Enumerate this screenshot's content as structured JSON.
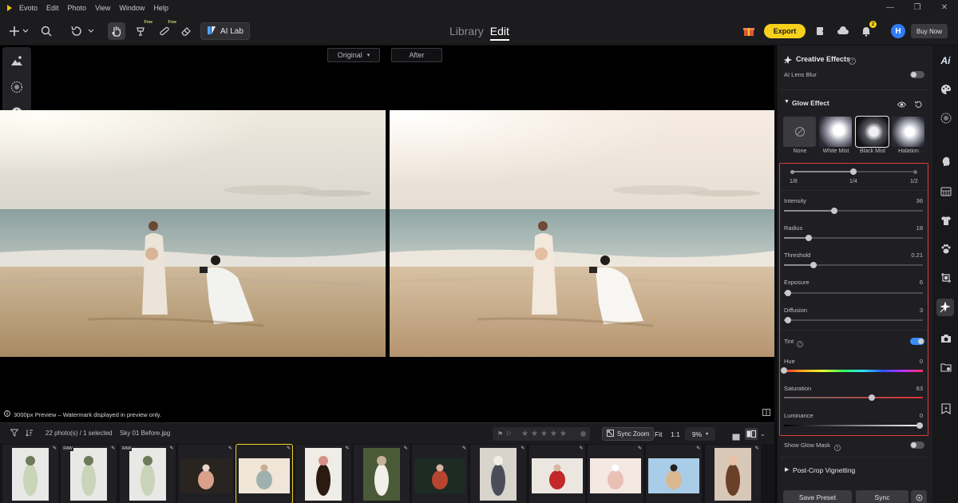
{
  "menubar": {
    "app_name": "Evoto",
    "items": [
      "Edit",
      "Photo",
      "View",
      "Window",
      "Help"
    ]
  },
  "toolbar": {
    "free_tag": "Free",
    "ai_lab_label": "AI Lab",
    "tabs": [
      {
        "label": "Library",
        "selected": false
      },
      {
        "label": "Edit",
        "selected": true
      }
    ],
    "export_label": "Export",
    "notif_count": "2",
    "avatar_letter": "H",
    "buy_now_label": "Buy Now"
  },
  "compare": {
    "original_label": "Original",
    "after_label": "After"
  },
  "preview_note": "3000px Preview – Watermark displayed in preview only.",
  "panel": {
    "section_title": "Creative Effects",
    "ai_lens_blur": "AI Lens Blur",
    "glow_title": "Glow Effect",
    "presets": [
      {
        "label": "None",
        "selected": false
      },
      {
        "label": "White Mist",
        "selected": false
      },
      {
        "label": "Black Mist",
        "selected": true
      },
      {
        "label": "Halation",
        "selected": false
      }
    ],
    "strength": {
      "labels": [
        "1/8",
        "1/4",
        "1/2"
      ],
      "value_index": 1
    },
    "sliders": [
      {
        "label": "Intensity",
        "value": "36",
        "fraction": 0.36
      },
      {
        "label": "Radius",
        "value": "18",
        "fraction": 0.18
      },
      {
        "label": "Threshold",
        "value": "0.21",
        "fraction": 0.21
      },
      {
        "label": "Exposure",
        "value": "6",
        "fraction": 0.03
      },
      {
        "label": "Diffusion",
        "value": "3",
        "fraction": 0.03
      }
    ],
    "tint_label": "Tint",
    "tint_on": true,
    "hue": {
      "label": "Hue",
      "value": "0",
      "fraction": 0.0
    },
    "saturation": {
      "label": "Saturation",
      "value": "63",
      "fraction": 0.63
    },
    "luminance": {
      "label": "Luminance",
      "value": "0",
      "fraction": 1.0
    },
    "show_glow_mask": "Show Glow Mask",
    "post_crop": "Post-Crop Vignetting",
    "save_preset": "Save Preset",
    "sync": "Sync"
  },
  "filmstrip": {
    "count_text": "22 photo(s) / 1 selected",
    "filename": "Sky 01 Before.jpg",
    "sync_zoom": "Sync Zoom",
    "fit": "Fit",
    "one_to_one": "1:1",
    "zoom": "9%",
    "raw_tag": "RAW",
    "thumbs": [
      {
        "kind": "portrait-light",
        "raw": false
      },
      {
        "kind": "portrait-light",
        "raw": true
      },
      {
        "kind": "portrait-light",
        "raw": true
      },
      {
        "kind": "group-dark",
        "raw": false
      },
      {
        "kind": "beach",
        "raw": false,
        "selected": true
      },
      {
        "kind": "curly",
        "raw": false
      },
      {
        "kind": "bride",
        "raw": false
      },
      {
        "kind": "redhead",
        "raw": false
      },
      {
        "kind": "couple",
        "raw": false
      },
      {
        "kind": "red",
        "raw": false
      },
      {
        "kind": "baby",
        "raw": false
      },
      {
        "kind": "beach2",
        "raw": false
      },
      {
        "kind": "woman",
        "raw": false
      }
    ]
  },
  "colors": {
    "accent_yellow": "#f5d11c",
    "highlight_red": "#e03a3a",
    "toggle_blue": "#3a8ef6",
    "avatar_blue": "#2f7cf6"
  }
}
